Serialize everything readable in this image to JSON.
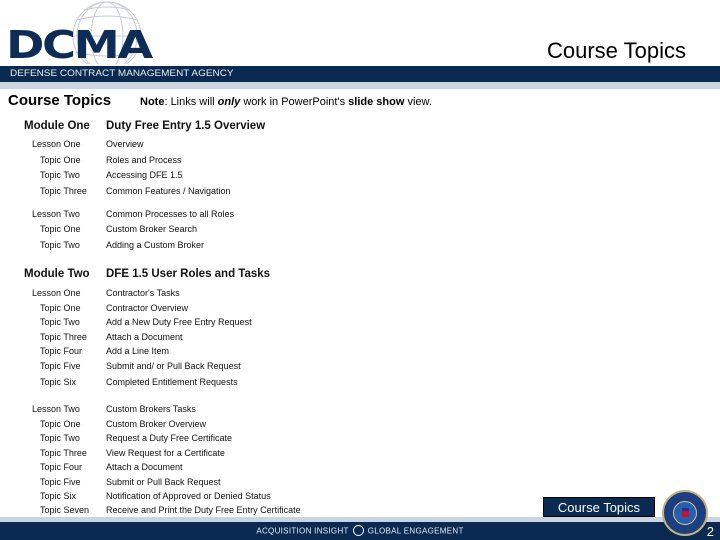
{
  "header": {
    "logo_text": "DCMA",
    "agency_name": "DEFENSE CONTRACT MANAGEMENT AGENCY",
    "title": "Course Topics"
  },
  "page": {
    "heading": "Course Topics",
    "note_label": "Note",
    "note_pre": ":   Links will ",
    "note_emph": "only",
    "note_mid": " work in PowerPoint's ",
    "note_bold": "slide show",
    "note_post": " view."
  },
  "outline": [
    {
      "type": "module",
      "label": "Module One",
      "title": "Duty Free Entry 1.5 Overview"
    },
    {
      "type": "lesson",
      "label": "Lesson One",
      "title": "Overview"
    },
    {
      "type": "topic",
      "label": "Topic One",
      "title": "Roles and Process"
    },
    {
      "type": "topic",
      "label": "Topic Two",
      "title": "Accessing DFE 1.5"
    },
    {
      "type": "topic",
      "label": "Topic Three",
      "title": "Common Features / Navigation"
    },
    {
      "type": "lesson",
      "label": "Lesson Two",
      "title": "Common Processes to all Roles"
    },
    {
      "type": "topic",
      "label": "Topic One",
      "title": "Custom Broker Search"
    },
    {
      "type": "topic",
      "label": "Topic Two",
      "title": "Adding a Custom Broker"
    },
    {
      "type": "module",
      "label": "Module Two",
      "title": "DFE 1.5 User Roles and Tasks"
    },
    {
      "type": "lesson",
      "label": "Lesson One",
      "title": "Contractor's Tasks"
    },
    {
      "type": "topic",
      "label": "Topic One",
      "title": "Contractor Overview"
    },
    {
      "type": "topic",
      "label": "Topic Two",
      "title": "Add a New Duty Free Entry Request"
    },
    {
      "type": "topic",
      "label": "Topic Three",
      "title": "Attach a Document"
    },
    {
      "type": "topic",
      "label": "Topic Four",
      "title": "Add a Line Item"
    },
    {
      "type": "topic",
      "label": "Topic Five",
      "title": "Submit and/ or Pull Back Request"
    },
    {
      "type": "topic",
      "label": "Topic Six",
      "title": "Completed Entitlement Requests"
    },
    {
      "type": "lesson",
      "label": "Lesson Two",
      "title": "Custom Brokers Tasks"
    },
    {
      "type": "topic",
      "label": "Topic One",
      "title": "Custom Broker Overview"
    },
    {
      "type": "topic",
      "label": "Topic Two",
      "title": "Request a Duty Free Certificate"
    },
    {
      "type": "topic",
      "label": "Topic Three",
      "title": "View Request for  a Certificate"
    },
    {
      "type": "topic",
      "label": "Topic Four",
      "title": "Attach a Document"
    },
    {
      "type": "topic",
      "label": "Topic Five",
      "title": "Submit or Pull Back Request"
    },
    {
      "type": "topic",
      "label": "Topic Six",
      "title": "Notification of Approved or Denied Status"
    },
    {
      "type": "topic",
      "label": "Topic Seven",
      "title": "Receive and Print the Duty Free Entry Certificate"
    }
  ],
  "footer": {
    "tagline_left": "ACQUISITION INSIGHT",
    "tagline_right": "GLOBAL ENGAGEMENT",
    "course_topics_button": "Course Topics",
    "page_number": "2"
  },
  "colors": {
    "navy": "#0b2a52",
    "logo_blue": "#0e2d56",
    "light_band": "#cbd5e1"
  }
}
